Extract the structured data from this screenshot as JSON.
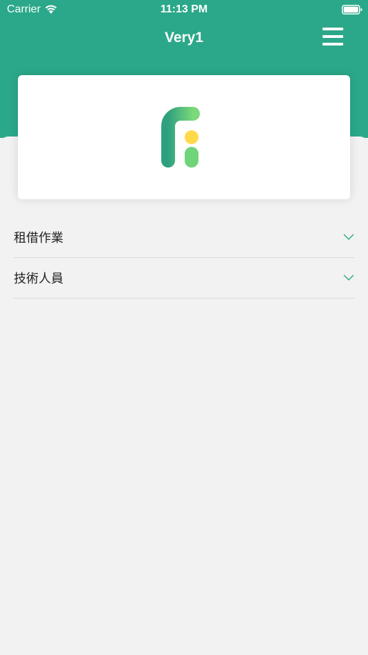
{
  "status_bar": {
    "carrier": "Carrier",
    "time": "11:13 PM"
  },
  "nav": {
    "title": "Very1",
    "menu_icon": "hamburger-menu-icon"
  },
  "colors": {
    "header_bg": "#2ba889",
    "page_bg": "#f2f2f2",
    "chevron": "#2ba889",
    "logo_dark_green": "#1f8a7a",
    "logo_light_green": "#6fd47a",
    "logo_yellow": "#ffd94a"
  },
  "logo": {
    "icon": "app-logo-icon"
  },
  "sections": [
    {
      "label": "租借作業",
      "icon": "chevron-down-icon"
    },
    {
      "label": "技術人員",
      "icon": "chevron-down-icon"
    }
  ]
}
